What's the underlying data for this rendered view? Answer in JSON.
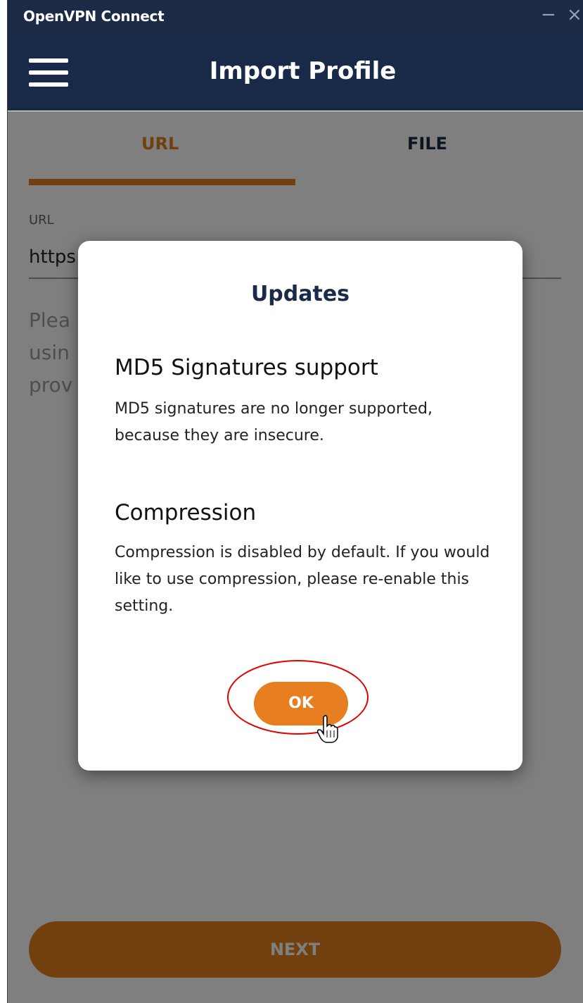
{
  "window": {
    "title": "OpenVPN Connect",
    "minimize_glyph": "−",
    "close_glyph": "×"
  },
  "header": {
    "menu_icon": "hamburger-menu-icon",
    "title": "Import Profile"
  },
  "tabs": [
    {
      "label": "URL",
      "active": true
    },
    {
      "label": "FILE",
      "active": false
    }
  ],
  "url_field": {
    "label": "URL",
    "value": "https:"
  },
  "help_text": "Plea\nusin\nprov",
  "next_button": {
    "label": "NEXT"
  },
  "modal": {
    "title": "Updates",
    "sections": [
      {
        "heading": "MD5 Signatures support",
        "body": "MD5 signatures are no longer supported, because they are insecure."
      },
      {
        "heading": "Compression",
        "body": "Compression is disabled by default. If you would like to use compression, please re-enable this setting."
      }
    ],
    "ok_button": {
      "label": "OK"
    }
  },
  "colors": {
    "header_bg": "#182a47",
    "accent_orange": "#e47f1e",
    "modal_title": "#1b2a48",
    "highlight_red": "#e00000"
  }
}
